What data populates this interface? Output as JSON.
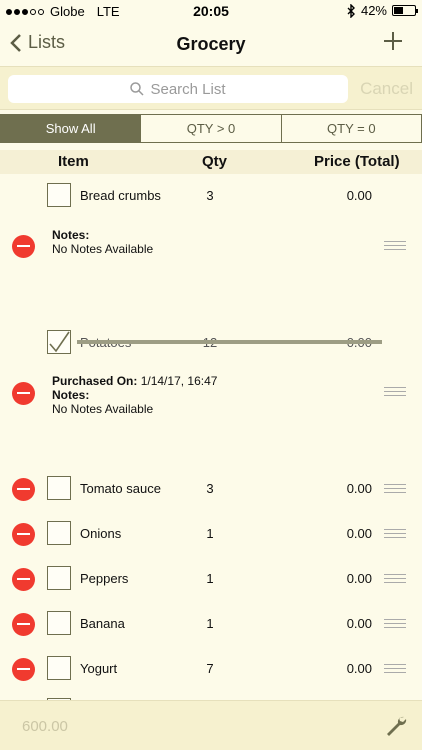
{
  "status_bar": {
    "carrier": "Globe",
    "network": "LTE",
    "time": "20:05",
    "battery": "42%",
    "signal_bars": 3,
    "battery_level": 0.42
  },
  "nav": {
    "back_label": "Lists",
    "title": "Grocery",
    "add_icon": "plus-icon"
  },
  "search": {
    "placeholder": "Search List",
    "cancel_label": "Cancel"
  },
  "filters": [
    "Show All",
    "QTY > 0",
    "QTY = 0"
  ],
  "columns": {
    "item": "Item",
    "qty": "Qty",
    "price": "Price (Total)"
  },
  "items": [
    {
      "name": "Bread crumbs",
      "qty": "3",
      "price": "0.00",
      "checked": false,
      "notes_label": "Notes:",
      "notes": "No Notes Available"
    },
    {
      "name": "Potatoes",
      "qty": "12",
      "price": "0.00",
      "checked": true,
      "purchased_label": "Purchased On:",
      "purchased_on": "1/14/17, 16:47",
      "notes_label": "Notes:",
      "notes": "No Notes Available"
    },
    {
      "name": "Tomato sauce",
      "qty": "3",
      "price": "0.00",
      "checked": false
    },
    {
      "name": "Onions",
      "qty": "1",
      "price": "0.00",
      "checked": false
    },
    {
      "name": "Peppers",
      "qty": "1",
      "price": "0.00",
      "checked": false
    },
    {
      "name": "Banana",
      "qty": "1",
      "price": "0.00",
      "checked": false
    },
    {
      "name": "Yogurt",
      "qty": "7",
      "price": "0.00",
      "checked": false
    }
  ],
  "footer": {
    "total": "600.00",
    "settings_icon": "wrench-icon"
  },
  "colors": {
    "accent": "#6f6f4f",
    "background": "#fdfbe9",
    "delete": "#f03a2f"
  }
}
